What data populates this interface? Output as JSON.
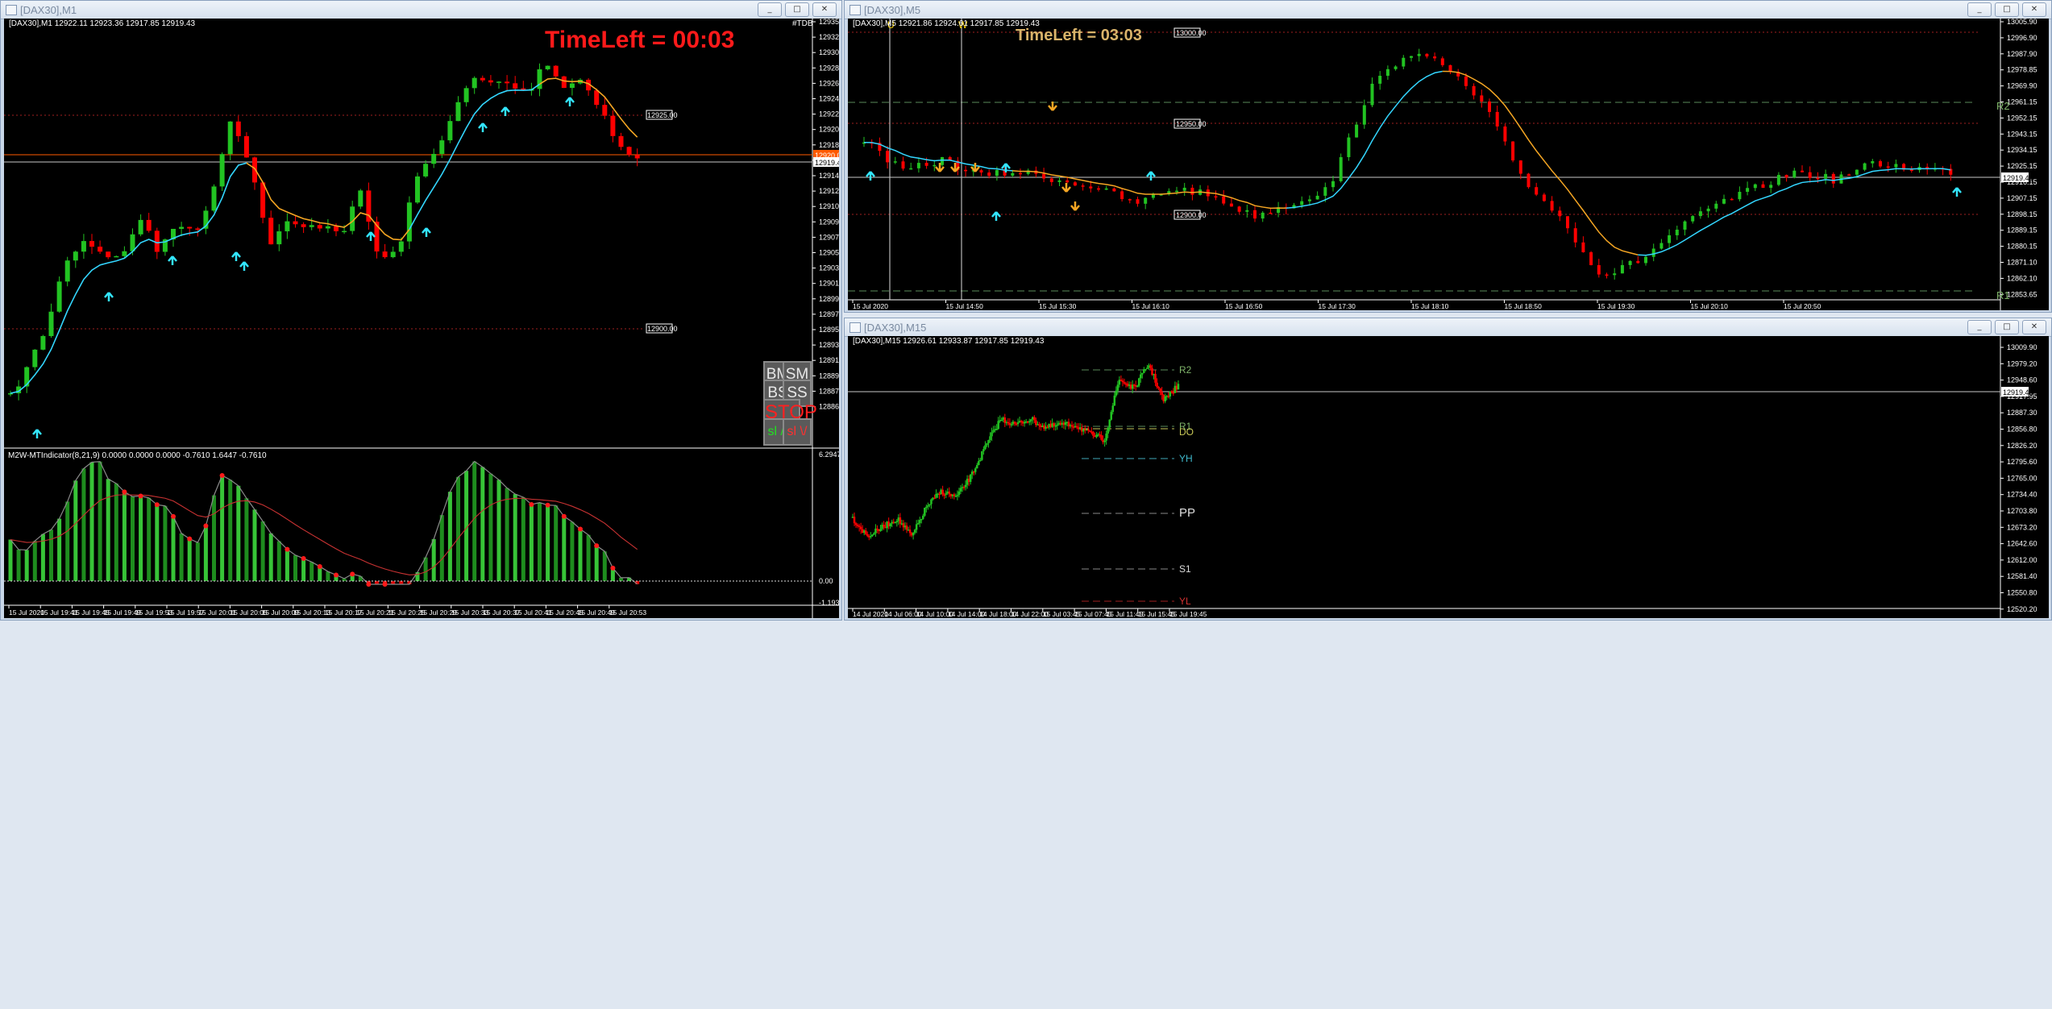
{
  "windows": {
    "m1": {
      "title": "[DAX30],M1",
      "info": "[DAX30],M1  12922.11 12923.36 12917.85 12919.43",
      "timeleft": "TimeLeft = 00:03",
      "tag": "#TDB",
      "price_labels": [
        "12935.85",
        "12932.05",
        "12930.10",
        "12928.20",
        "12926.30",
        "12924.35",
        "12922.45",
        "12920.55",
        "12918.60",
        "12916.70",
        "12914.80",
        "12912.85",
        "12910.95",
        "12909.05",
        "12907.10",
        "12905.20",
        "12903.30",
        "12901.35",
        "12899.45",
        "12897.55",
        "12895.60",
        "12893.70",
        "12891.80",
        "12889.85",
        "12887.95",
        "12886.05"
      ],
      "current_price": "12919.43",
      "current_price2": "12920.03",
      "level_upper": "12925.00",
      "level_lower": "12900.00",
      "time_labels": [
        "15 Jul 2020",
        "15 Jul 19:41",
        "15 Jul 19:45",
        "15 Jul 19:49",
        "15 Jul 19:53",
        "15 Jul 19:57",
        "15 Jul 20:01",
        "15 Jul 20:05",
        "15 Jul 20:09",
        "15 Jul 20:13",
        "15 Jul 20:17",
        "15 Jul 20:21",
        "15 Jul 20:25",
        "15 Jul 20:29",
        "15 Jul 20:33",
        "15 Jul 20:37",
        "15 Jul 20:41",
        "15 Jul 20:45",
        "15 Jul 20:49",
        "15 Jul 20:53"
      ],
      "indicator_title": "M2W-MTIndicator(8,21,9) 0.0000 0.0000 0.0000 -0.7610 1.6447 -0.7610",
      "indicator_scale": [
        "6.2947",
        "0.00",
        "-1.1935"
      ],
      "panel_buttons": [
        "BM",
        "SM",
        "BS",
        "SS",
        "STOP",
        "sl /\\",
        "sl \\/"
      ]
    },
    "m5": {
      "title": "[DAX30],M5",
      "info": "[DAX30],M5  12921.86 12924.61 12917.85 12919.43",
      "timeleft": "TimeLeft = 03:03",
      "markers": [
        "U",
        "W"
      ],
      "price_labels": [
        "13005.90",
        "12996.90",
        "12987.90",
        "12978.85",
        "12969.90",
        "12961.15",
        "12952.15",
        "12943.15",
        "12934.15",
        "12925.15",
        "12916.15",
        "12907.15",
        "12898.15",
        "12889.15",
        "12880.15",
        "12871.10",
        "12862.10",
        "12853.65"
      ],
      "current_price": "12919.43",
      "levels": [
        "13000.00",
        "12950.00",
        "12900.00"
      ],
      "pivot_labels": [
        "R2",
        "R1"
      ],
      "time_labels": [
        "15 Jul 2020",
        "15 Jul 14:50",
        "15 Jul 15:30",
        "15 Jul 16:10",
        "15 Jul 16:50",
        "15 Jul 17:30",
        "15 Jul 18:10",
        "15 Jul 18:50",
        "15 Jul 19:30",
        "15 Jul 20:10",
        "15 Jul 20:50"
      ]
    },
    "m15": {
      "title": "[DAX30],M15",
      "info": "[DAX30],M15  12926.61 12933.87 12917.85 12919.43",
      "price_labels": [
        "13009.90",
        "12979.20",
        "12948.60",
        "12917.95",
        "12887.30",
        "12856.80",
        "12826.20",
        "12795.60",
        "12765.00",
        "12734.40",
        "12703.80",
        "12673.20",
        "12642.60",
        "12612.00",
        "12581.40",
        "12550.80",
        "12520.20"
      ],
      "current_price": "12919.43",
      "pivot_labels": [
        "R2",
        "R1",
        "DO",
        "YH",
        "PP",
        "S1",
        "YL"
      ],
      "time_labels": [
        "14 Jul 2020",
        "14 Jul 06:00",
        "14 Jul 10:00",
        "14 Jul 14:00",
        "14 Jul 18:00",
        "14 Jul 22:00",
        "15 Jul 03:45",
        "15 Jul 07:45",
        "15 Jul 11:45",
        "15 Jul 15:45",
        "15 Jul 19:45"
      ]
    }
  },
  "window_buttons": [
    "_",
    "□",
    "✕"
  ],
  "colors": {
    "bull": "#22c322",
    "bear": "#ff0000",
    "ma_up": "#33d6ff",
    "ma_down": "#f5a623",
    "timeleft_m1": "#ff1a1a",
    "timeleft_m5": "#d9b36a"
  }
}
